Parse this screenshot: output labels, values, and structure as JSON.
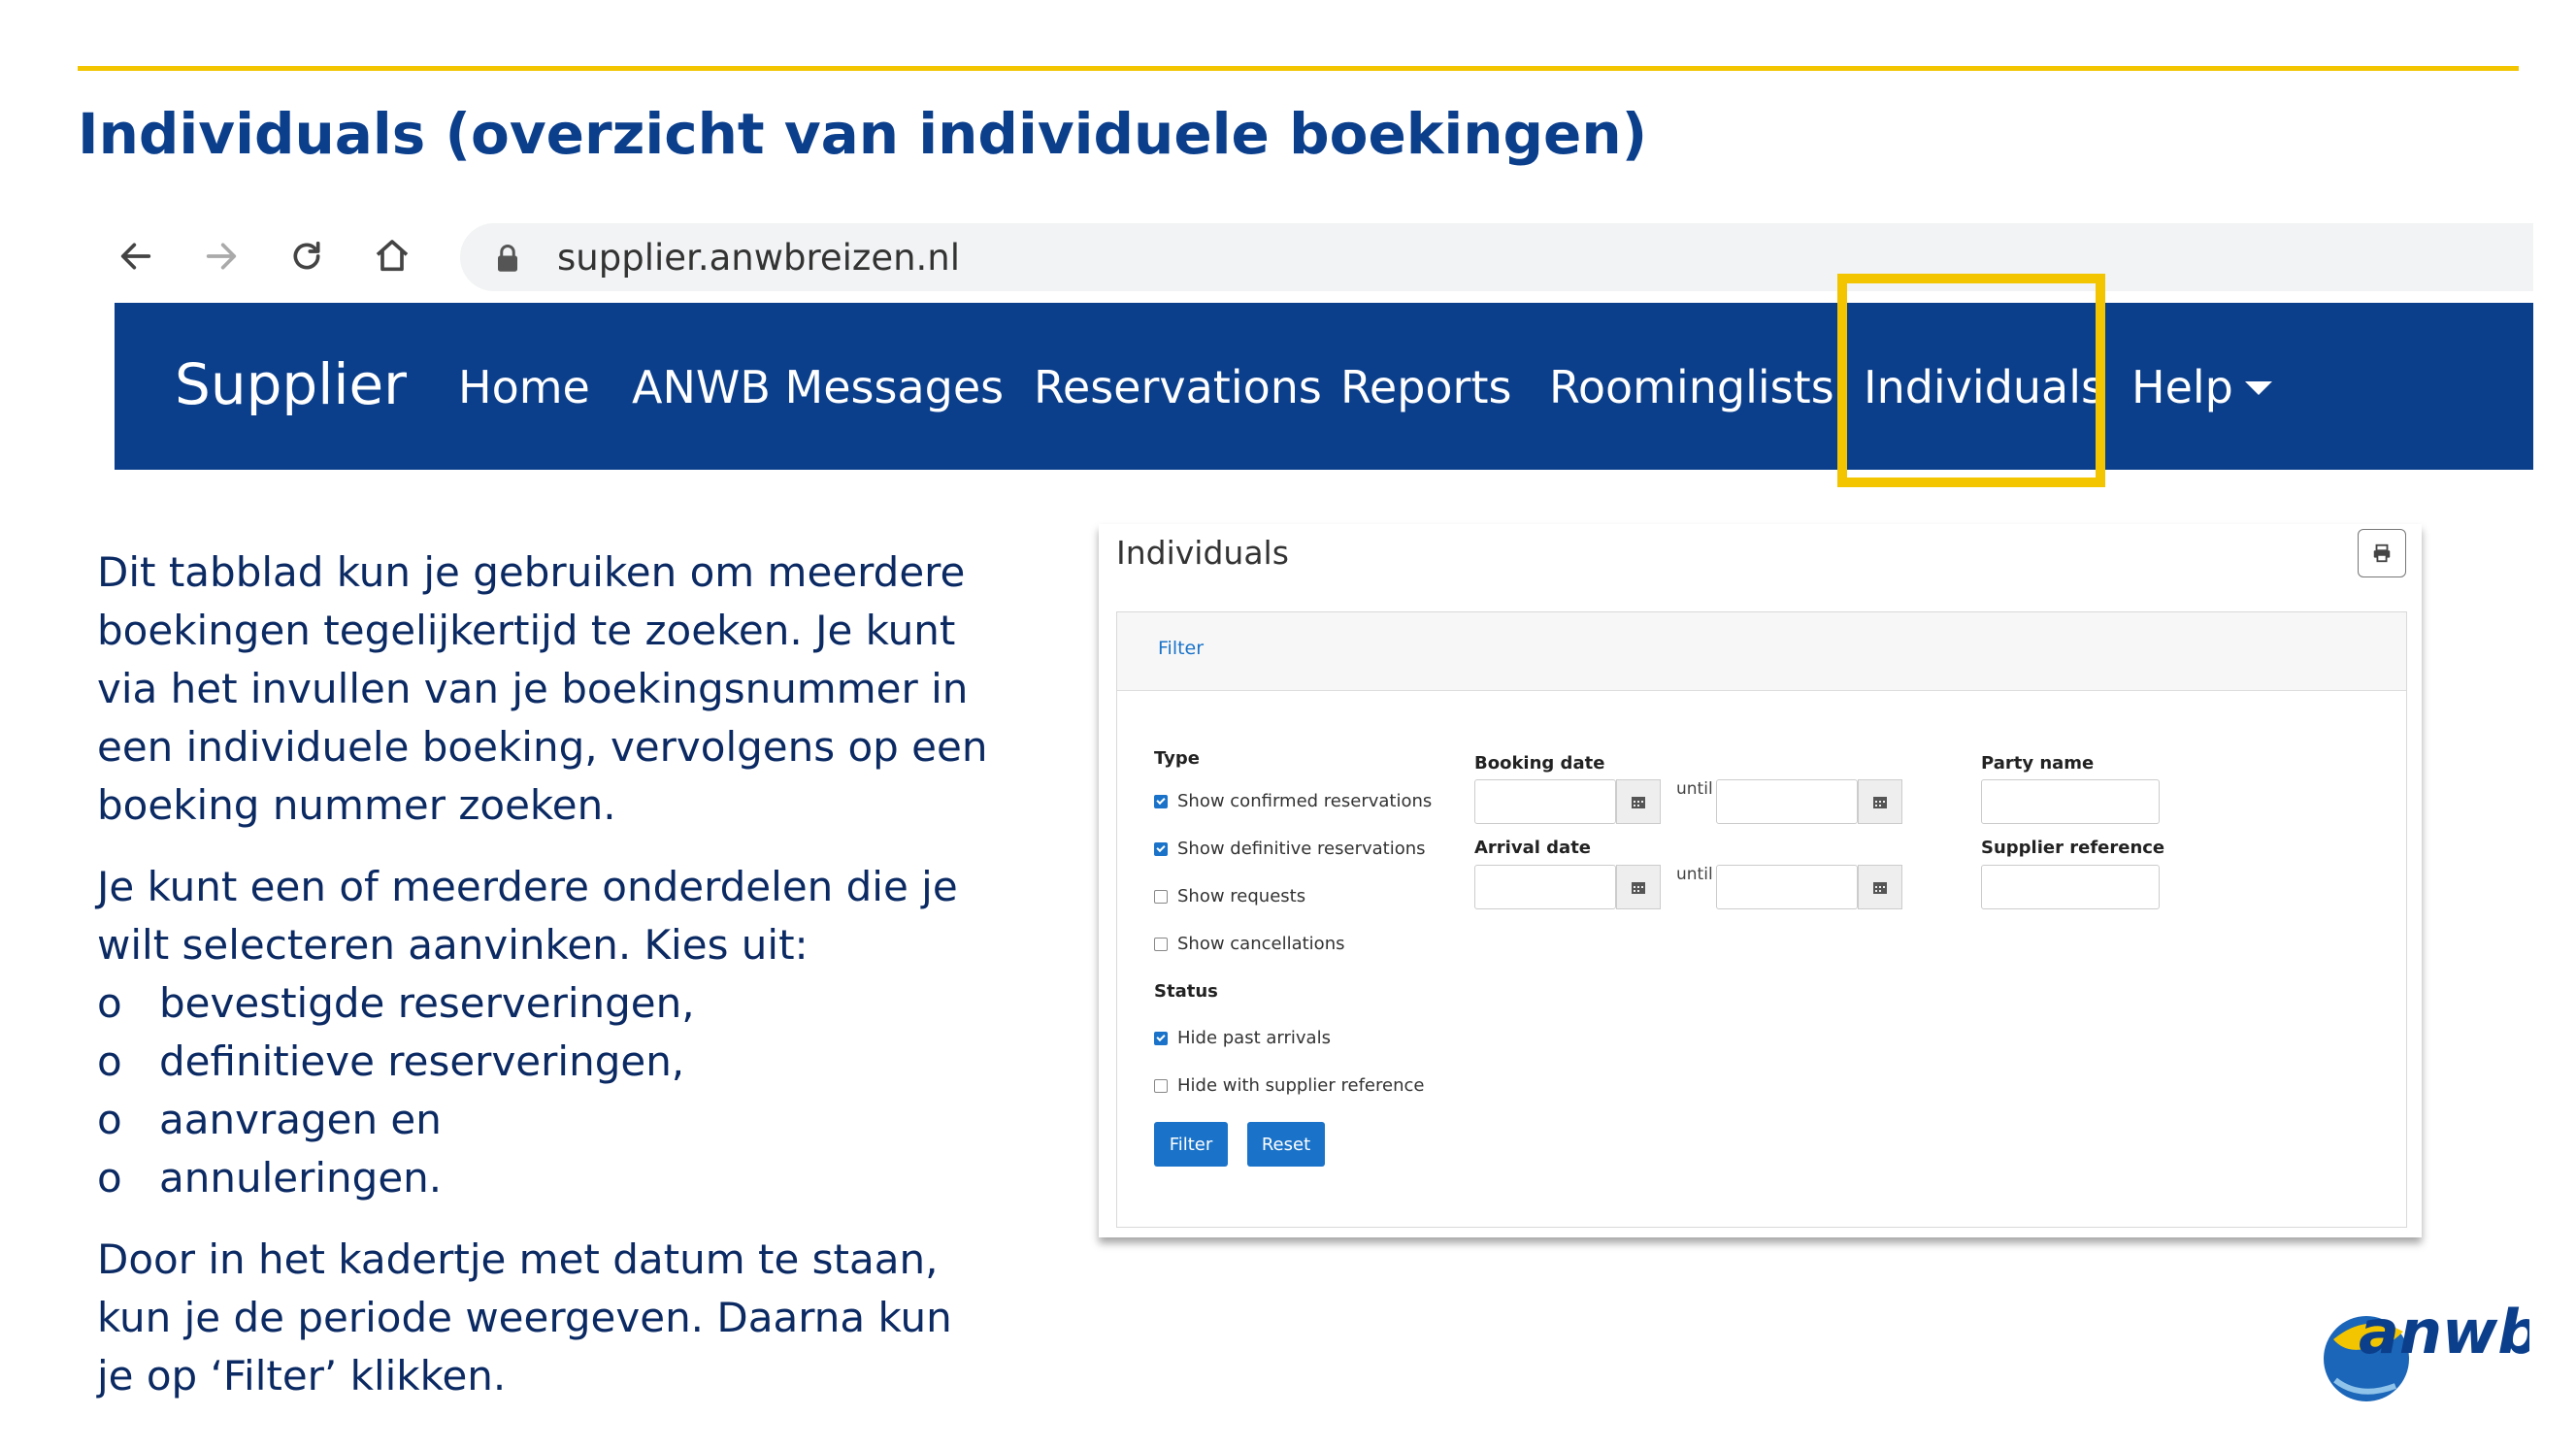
{
  "slide": {
    "title": "Individuals (overzicht van individuele boekingen)"
  },
  "browser": {
    "url": "supplier.anwbreizen.nl",
    "icons": [
      "back-icon",
      "forward-icon",
      "reload-icon",
      "home-icon",
      "lock-icon"
    ]
  },
  "navbar": {
    "brand": "Supplier",
    "items": [
      "Home",
      "ANWB Messages",
      "Reservations",
      "Reports",
      "Roominglists",
      "Individuals",
      "Help"
    ],
    "highlight_color": "#f2c500",
    "bg_color": "#0b3f8c"
  },
  "description": {
    "p1": "Dit tabblad kun je gebruiken om meerdere boekingen tegelijkertijd te zoeken. Je kunt via het invullen van je boekingsnummer in een individuele boeking, vervolgens op een boeking nummer zoeken.",
    "p2": "Je kunt een of meerdere onderdelen die je wilt selecteren aanvinken. Kies uit:",
    "bullet": "o",
    "list": [
      "bevestigde reserveringen,",
      "definitieve reserveringen,",
      "aanvragen en",
      "annuleringen."
    ],
    "p3": "Door in het kadertje met datum te staan, kun je de periode weergeven. Daarna kun je op  ‘Filter’ klikken."
  },
  "panel": {
    "title": "Individuals",
    "filter_tab": "Filter",
    "type_label": "Type",
    "type_options": [
      {
        "label": "Show confirmed reservations",
        "checked": true
      },
      {
        "label": "Show definitive reservations",
        "checked": true
      },
      {
        "label": "Show requests",
        "checked": false
      },
      {
        "label": "Show cancellations",
        "checked": false
      }
    ],
    "status_label": "Status",
    "status_options": [
      {
        "label": "Hide past arrivals",
        "checked": true
      },
      {
        "label": "Hide with supplier reference",
        "checked": false
      }
    ],
    "booking_date_label": "Booking date",
    "arrival_date_label": "Arrival date",
    "until": "until",
    "party_name_label": "Party name",
    "supplier_reference_label": "Supplier reference",
    "filter_button": "Filter",
    "reset_button": "Reset"
  },
  "logo": {
    "text": "anwb"
  }
}
